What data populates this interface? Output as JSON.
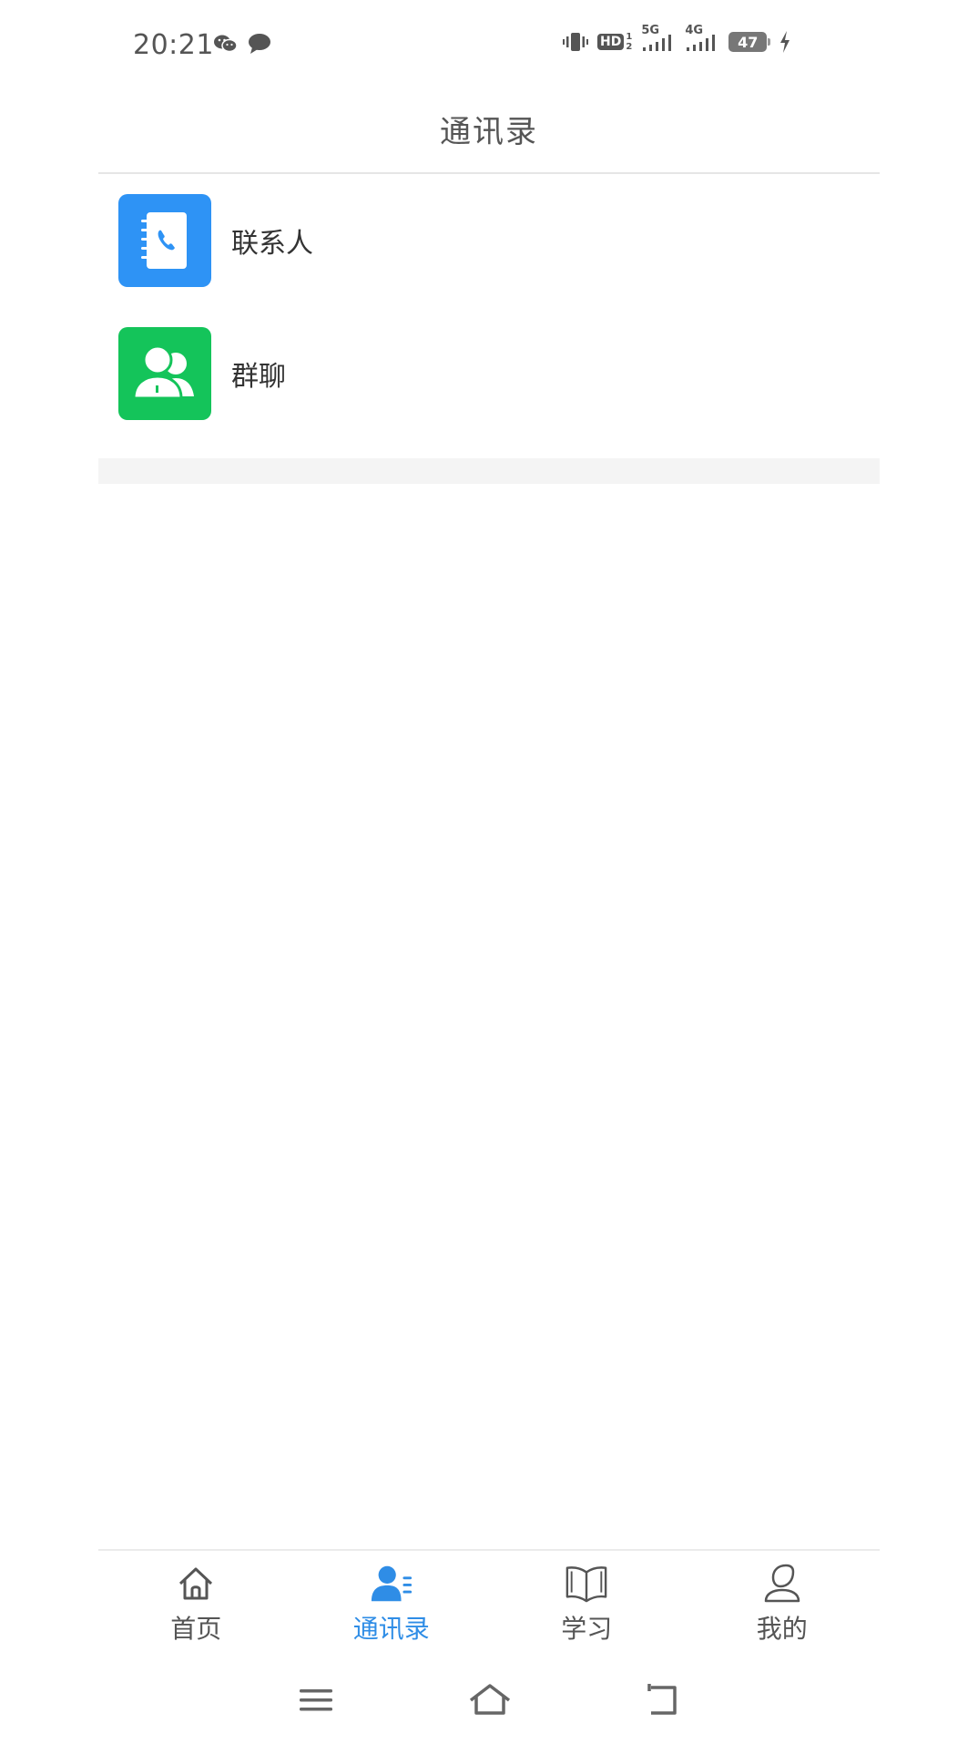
{
  "status_bar": {
    "time": "20:21",
    "left_icons": [
      "wechat-icon",
      "message-bubble-icon"
    ],
    "right_icons": [
      "vibrate-icon",
      "hd-icon",
      "signal-5g-icon",
      "signal-4g-icon",
      "battery-icon",
      "charging-icon"
    ],
    "hd_label": "HD",
    "sim_1": "1",
    "sim_2": "2",
    "net_5g": "5G",
    "net_4g": "4G",
    "battery_level": "47",
    "accent_color": "#555555"
  },
  "header": {
    "title": "通讯录"
  },
  "list": {
    "items": [
      {
        "label": "联系人",
        "icon": "contacts-book-icon",
        "color": "#2e93f5"
      },
      {
        "label": "群聊",
        "icon": "group-chat-icon",
        "color": "#14c45a"
      }
    ]
  },
  "bottom_nav": {
    "tabs": [
      {
        "label": "首页",
        "icon": "home-icon",
        "active": false
      },
      {
        "label": "通讯录",
        "icon": "contacts-icon",
        "active": true
      },
      {
        "label": "学习",
        "icon": "book-icon",
        "active": false
      },
      {
        "label": "我的",
        "icon": "profile-icon",
        "active": false
      }
    ],
    "active_color": "#2f8de6",
    "inactive_color": "#555555"
  },
  "system_nav": {
    "buttons": [
      "menu-icon",
      "home-outline-icon",
      "back-icon"
    ]
  }
}
